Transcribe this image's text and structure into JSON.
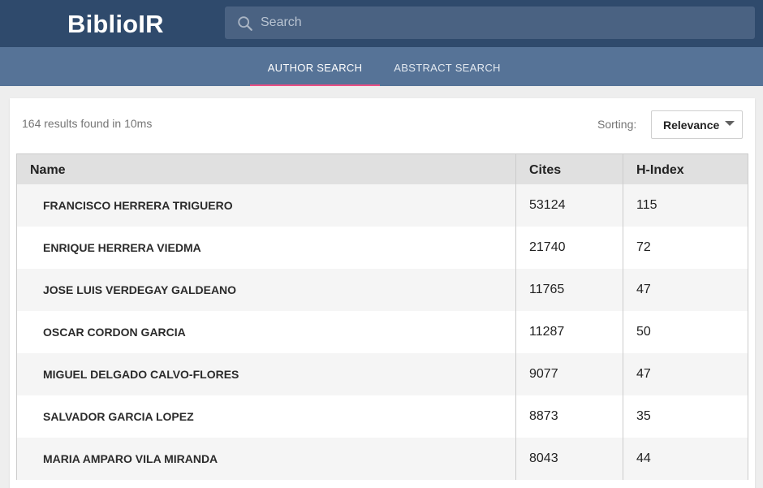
{
  "app": {
    "title": "BiblioIR"
  },
  "search": {
    "placeholder": "Search",
    "value": ""
  },
  "tabs": [
    {
      "label": "AUTHOR SEARCH",
      "active": true
    },
    {
      "label": "ABSTRACT SEARCH",
      "active": false
    }
  ],
  "results": {
    "summary": "164 results found in 10ms"
  },
  "sorting": {
    "label": "Sorting:",
    "value": "Relevance"
  },
  "table": {
    "columns": [
      "Name",
      "Cites",
      "H-Index"
    ],
    "rows": [
      {
        "name": "FRANCISCO HERRERA TRIGUERO",
        "cites": "53124",
        "h_index": "115"
      },
      {
        "name": "ENRIQUE HERRERA VIEDMA",
        "cites": "21740",
        "h_index": "72"
      },
      {
        "name": "JOSE LUIS VERDEGAY GALDEANO",
        "cites": "11765",
        "h_index": "47"
      },
      {
        "name": "OSCAR CORDON GARCIA",
        "cites": "11287",
        "h_index": "50"
      },
      {
        "name": "MIGUEL DELGADO CALVO-FLORES",
        "cites": "9077",
        "h_index": "47"
      },
      {
        "name": "SALVADOR GARCIA LOPEZ",
        "cites": "8873",
        "h_index": "35"
      },
      {
        "name": "MARIA AMPARO VILA MIRANDA",
        "cites": "8043",
        "h_index": "44"
      }
    ]
  },
  "colors": {
    "header": "#2f4a6c",
    "tabbar": "#567397",
    "tab_indicator": "#ea4f84"
  },
  "icons": {
    "search": "search-icon",
    "dropdown": "chevron-down-icon"
  }
}
